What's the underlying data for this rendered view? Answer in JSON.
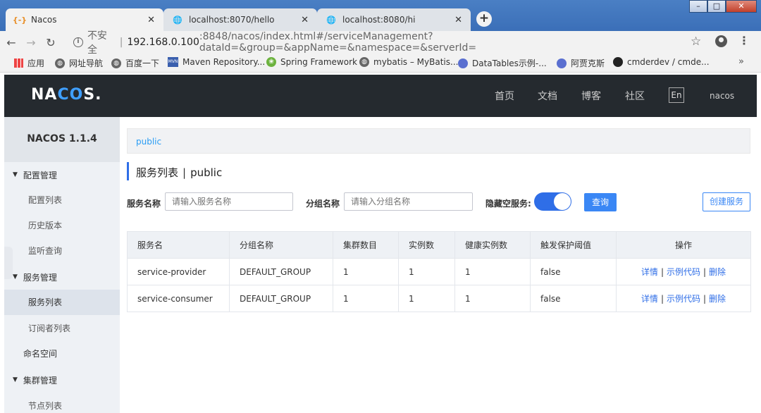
{
  "browser": {
    "tabs": [
      {
        "title": "Nacos",
        "active": true
      },
      {
        "title": "localhost:8070/hello",
        "active": false
      },
      {
        "title": "localhost:8080/hi",
        "active": false
      }
    ],
    "address": {
      "insecure_label": "不安全",
      "separator": "|",
      "host": "192.168.0.100",
      "path": ":8848/nacos/index.html#/serviceManagement?dataId=&group=&appName=&namespace=&serverId="
    },
    "bookmarks": [
      {
        "label": "应用",
        "icon": "apps-icon"
      },
      {
        "label": "网址导航",
        "icon": "globe-icon"
      },
      {
        "label": "百度一下",
        "icon": "globe-icon"
      },
      {
        "label": "Maven Repository...",
        "icon": "mvn-icon"
      },
      {
        "label": "Spring Framework",
        "icon": "spring-icon"
      },
      {
        "label": "mybatis – MyBatis...",
        "icon": "globe-icon"
      },
      {
        "label": "DataTables示例-...",
        "icon": "circle-icon"
      },
      {
        "label": "阿贾克斯",
        "icon": "circle-icon"
      },
      {
        "label": "cmderdev / cmde...",
        "icon": "github-icon"
      }
    ],
    "more_label": "»"
  },
  "header": {
    "logo": {
      "part1": "NA",
      "part2": "C",
      "part3": "O",
      "part4": "S."
    },
    "nav": [
      "首页",
      "文档",
      "博客",
      "社区"
    ],
    "lang_button": "En",
    "user": "nacos"
  },
  "sidebar": {
    "version": "NACOS 1.1.4",
    "groups": [
      {
        "label": "配置管理",
        "items": [
          "配置列表",
          "历史版本",
          "监听查询"
        ]
      },
      {
        "label": "服务管理",
        "items": [
          "服务列表",
          "订阅者列表"
        ]
      },
      {
        "label": "命名空间",
        "items": []
      },
      {
        "label": "集群管理",
        "items": [
          "节点列表"
        ]
      }
    ]
  },
  "main": {
    "breadcrumb": "public",
    "title": "服务列表",
    "title_sep": "|",
    "title_ns": "public",
    "filters": {
      "service_name_label": "服务名称",
      "service_name_placeholder": "请输入服务名称",
      "group_name_label": "分组名称",
      "group_name_placeholder": "请输入分组名称",
      "hide_empty_label": "隐藏空服务:",
      "hide_empty_on": true,
      "query_button": "查询",
      "create_button": "创建服务"
    },
    "table": {
      "columns": [
        "服务名",
        "分组名称",
        "集群数目",
        "实例数",
        "健康实例数",
        "触发保护阈值",
        "操作"
      ],
      "rows": [
        [
          "service-provider",
          "DEFAULT_GROUP",
          "1",
          "1",
          "1",
          "false"
        ],
        [
          "service-consumer",
          "DEFAULT_GROUP",
          "1",
          "1",
          "1",
          "false"
        ]
      ],
      "actions": [
        "详情",
        "示例代码",
        "删除"
      ],
      "action_sep": "|"
    }
  },
  "colors": {
    "header_bg": "#252a2f",
    "primary": "#2f6ee7",
    "link": "#2a9df4",
    "sidebar_bg": "#eef1f5"
  }
}
